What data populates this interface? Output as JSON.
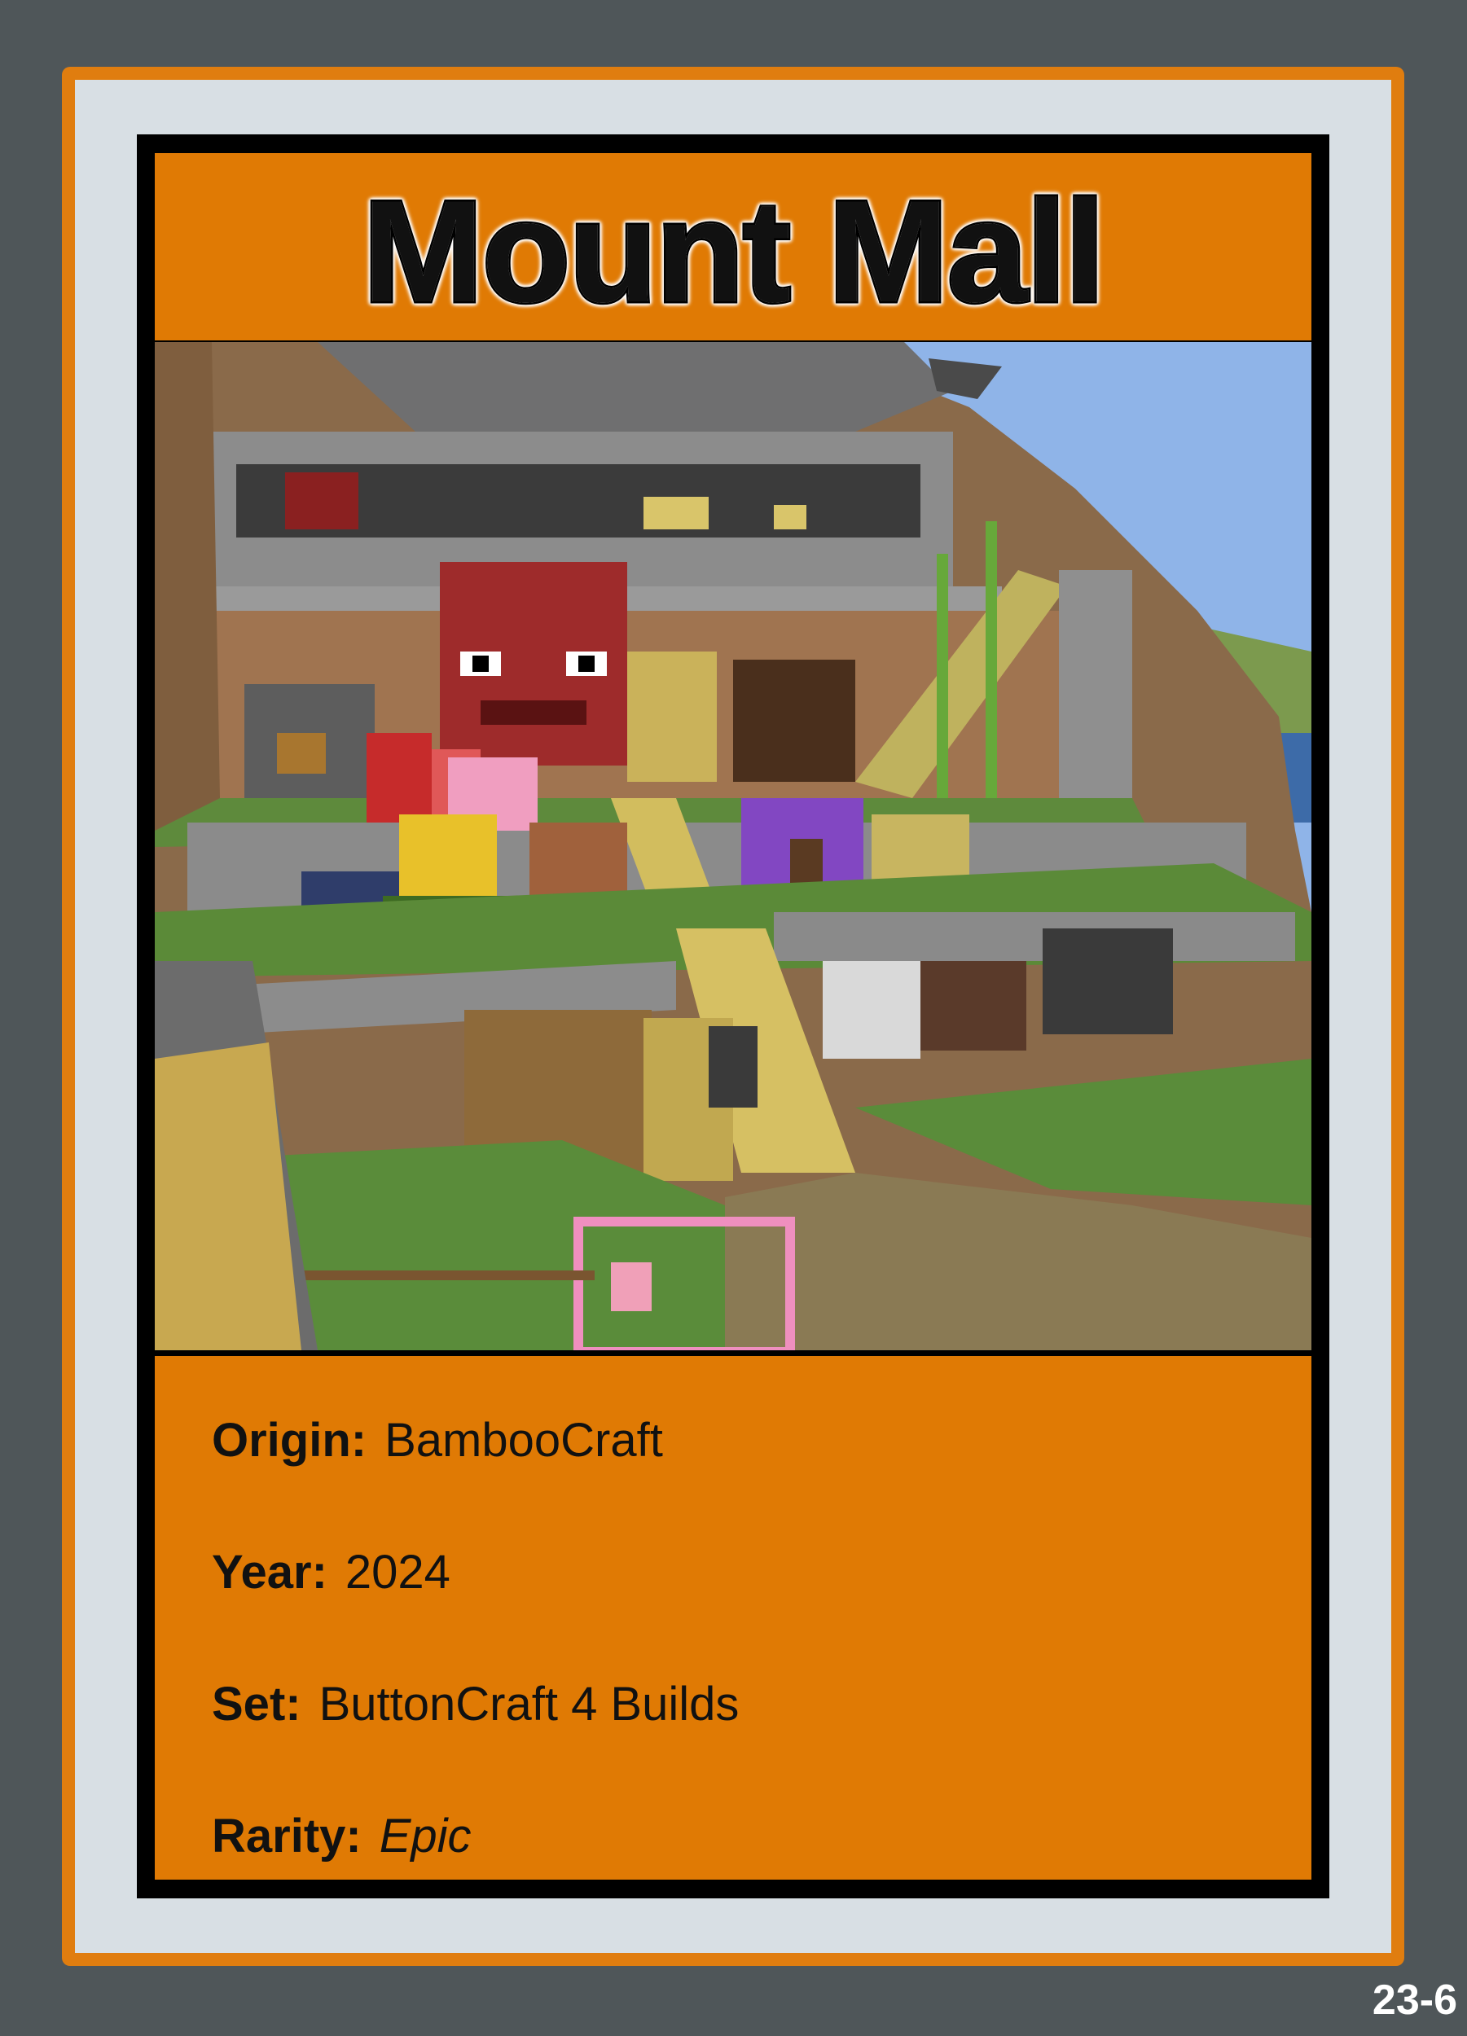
{
  "card": {
    "title": "Mount Mall",
    "image_alt": "Minecraft build: terraced mountain mall with stone walls, staircases and shop fronts",
    "fields": [
      {
        "label": "Origin:",
        "value": "BambooCraft"
      },
      {
        "label": "Year:",
        "value": "2024"
      },
      {
        "label": "Set:",
        "value": "ButtonCraft 4 Builds"
      },
      {
        "label": "Rarity:",
        "value": "Epic"
      }
    ],
    "card_number": "23-6"
  },
  "colors": {
    "background": "#4f5659",
    "accent_orange": "#e07a04",
    "border_light": "#d8dfe4",
    "frame_black": "#000000"
  }
}
